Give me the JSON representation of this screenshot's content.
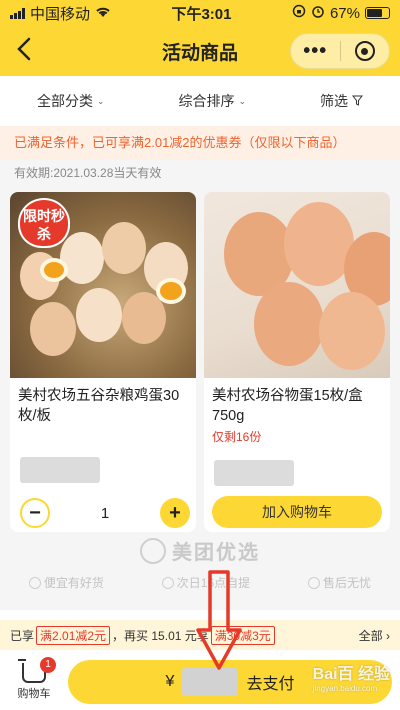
{
  "status_bar": {
    "carrier": "中国移动",
    "time": "下午3:01",
    "battery": "67%"
  },
  "nav": {
    "title": "活动商品",
    "more_icon": "more-dots-icon",
    "close_icon": "close-circle-icon"
  },
  "filters": [
    {
      "label": "全部分类"
    },
    {
      "label": "综合排序"
    },
    {
      "label": "筛选"
    }
  ],
  "notice": "已满足条件，已可享满2.01减2的优惠券（仅限以下商品）",
  "validity": "有效期:2021.03.28当天有效",
  "products": [
    {
      "name": "美村农场五谷杂粮鸡蛋30枚/板",
      "badge": "限时秒杀",
      "quantity": "1"
    },
    {
      "name": "美村农场谷物蛋15枚/盒750g",
      "stock": "仅剩16份",
      "add_cart_label": "加入购物车"
    }
  ],
  "brand": {
    "name": "美团优选",
    "features": [
      "便宜有好货",
      "次日16点自提",
      "售后无忧"
    ]
  },
  "coupon_bar": {
    "prefix": "已享",
    "tag1": "满2.01减2元",
    "middle": "，再买 15.01 元享",
    "tag2": "满30减3元",
    "all": "全部"
  },
  "bottom": {
    "cart_label": "购物车",
    "cart_badge": "1",
    "currency": "¥",
    "pay_label": "去支付"
  },
  "watermark": {
    "text": "Bai百 经验",
    "sub": "jingyan.baidu.com"
  },
  "colors": {
    "accent": "#fdd835",
    "red": "#e53a2b",
    "notice_text": "#f0632e"
  }
}
